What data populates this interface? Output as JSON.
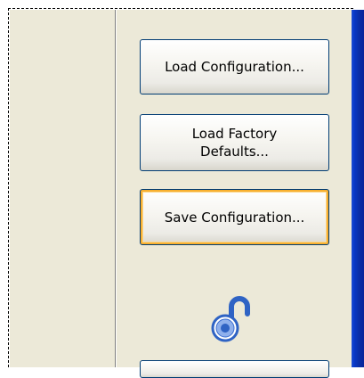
{
  "buttons": {
    "load_configuration": "Load Configuration...",
    "load_factory_defaults": "Load Factory\nDefaults...",
    "save_configuration": "Save Configuration..."
  },
  "icons": {
    "unlock": "unlocked-padlock-icon"
  },
  "colors": {
    "panel_background": "#ece9d8",
    "button_border": "#003c74",
    "focus_ring": "#f8b030",
    "lock_blue": "#2f63c4",
    "edge_blue": "#0a2fa8"
  }
}
